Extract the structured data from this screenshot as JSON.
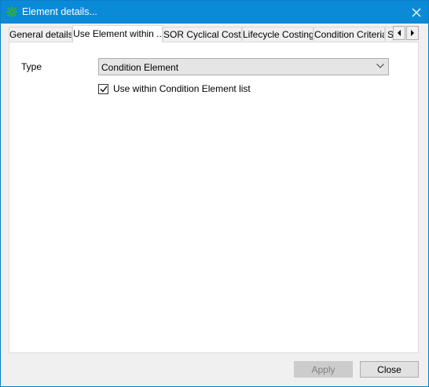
{
  "window": {
    "title": "Element details...",
    "app_icon": "gear-app-icon",
    "close_icon": "close-icon"
  },
  "tabs": [
    {
      "label": "General details",
      "active": false
    },
    {
      "label": "Use Element within ..",
      "active": true
    },
    {
      "label": "SOR Cyclical Costs",
      "active": false
    },
    {
      "label": "Lifecycle Costing",
      "active": false
    },
    {
      "label": "Condition Criteria",
      "active": false
    },
    {
      "label": "S",
      "active": false
    }
  ],
  "tab_scroll": {
    "left_icon": "triangle-left-icon",
    "right_icon": "triangle-right-icon"
  },
  "form": {
    "type_label": "Type",
    "type_value": "Condition Element",
    "use_within_label": "Use within Condition Element list",
    "use_within_checked": true
  },
  "footer": {
    "apply_label": "Apply",
    "apply_enabled": false,
    "close_label": "Close"
  },
  "colors": {
    "titlebar": "#0b8ad8",
    "window_bg": "#f0f0f0",
    "icon_green": "#2fae3a"
  }
}
